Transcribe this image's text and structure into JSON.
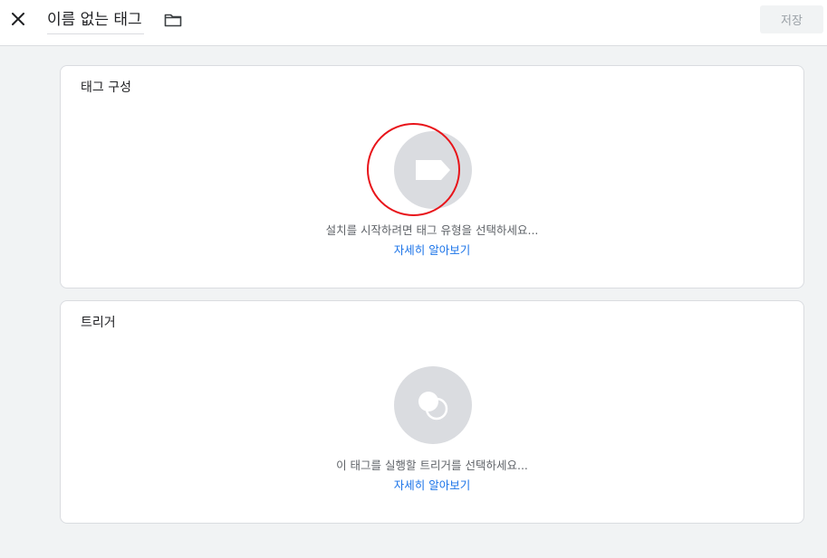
{
  "header": {
    "title": "이름 없는 태그",
    "save_label": "저장"
  },
  "tag_config": {
    "title": "태그 구성",
    "hint": "설치를 시작하려면 태그 유형을 선택하세요...",
    "learn_more": "자세히 알아보기"
  },
  "trigger": {
    "title": "트리거",
    "hint": "이 태그를 실행할 트리거를 선택하세요...",
    "learn_more": "자세히 알아보기"
  },
  "icons": {
    "close": "close-icon",
    "folder": "folder-icon",
    "tag": "tag-icon",
    "trigger": "trigger-icon"
  },
  "colors": {
    "link": "#1a73e8",
    "highlight_ring": "#e8141a",
    "placeholder_circle": "#dadce0"
  }
}
